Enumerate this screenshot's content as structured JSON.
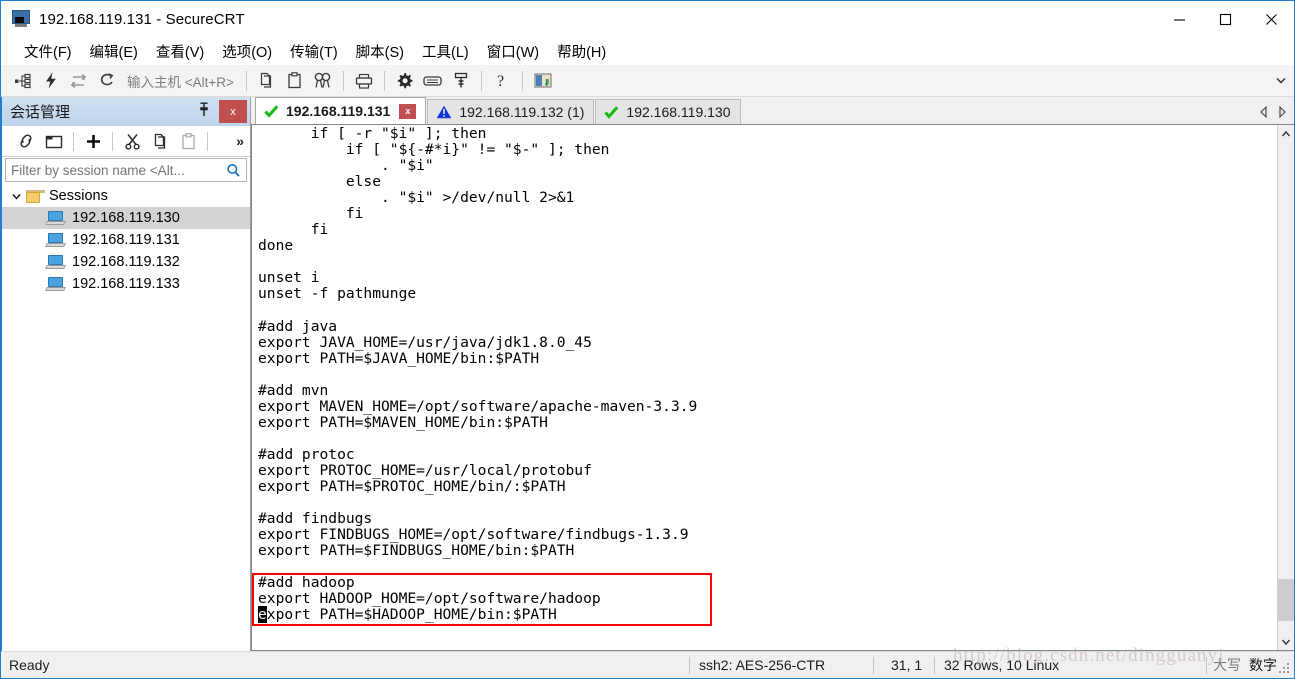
{
  "window": {
    "title": "192.168.119.131 - SecureCRT",
    "icon": "securecrt-icon",
    "minimize": "—",
    "maximize": "□",
    "close": "✕"
  },
  "menubar": {
    "items": [
      {
        "label": "文件(F)",
        "name": "menu-file"
      },
      {
        "label": "编辑(E)",
        "name": "menu-edit"
      },
      {
        "label": "查看(V)",
        "name": "menu-view"
      },
      {
        "label": "选项(O)",
        "name": "menu-options"
      },
      {
        "label": "传输(T)",
        "name": "menu-transfer"
      },
      {
        "label": "脚本(S)",
        "name": "menu-script"
      },
      {
        "label": "工具(L)",
        "name": "menu-tools"
      },
      {
        "label": "窗口(W)",
        "name": "menu-window"
      },
      {
        "label": "帮助(H)",
        "name": "menu-help"
      }
    ]
  },
  "toolbar": {
    "host_placeholder": "输入主机 <Alt+R>",
    "icons": [
      "new-session-icon",
      "quick-connect-icon",
      "reconnect-icon",
      "reconnect-all-icon",
      "copy-icon",
      "paste-icon",
      "find-icon",
      "print-icon",
      "session-options-icon",
      "keymap-editor-icon",
      "filter-icon",
      "help-icon",
      "session-manager-toggle-icon"
    ],
    "dropdown": "chevron-down-icon"
  },
  "session_manager": {
    "title": "会话管理",
    "pin": "pin-icon",
    "close": "x",
    "toolbar_icons": [
      "connect-icon",
      "connect-in-tab-icon",
      "new-session-icon",
      "cut-icon",
      "copy-icon",
      "paste-icon"
    ],
    "overflow": "»",
    "filter_placeholder": "Filter by session name <Alt...",
    "filter_value": "",
    "search_icon": "search-icon",
    "tree": {
      "root": {
        "label": "Sessions",
        "expanded": true,
        "arrow": "chevron-down-icon",
        "icon": "folder-icon"
      },
      "children": [
        {
          "label": "192.168.119.130",
          "icon": "monitor-icon",
          "selected": true
        },
        {
          "label": "192.168.119.131",
          "icon": "monitor-icon",
          "selected": false
        },
        {
          "label": "192.168.119.132",
          "icon": "monitor-icon",
          "selected": false
        },
        {
          "label": "192.168.119.133",
          "icon": "monitor-icon",
          "selected": false
        }
      ]
    }
  },
  "tabs": {
    "items": [
      {
        "label": "192.168.119.131",
        "status": "connected",
        "active": true,
        "closable": true,
        "close_label": "x"
      },
      {
        "label": "192.168.119.132 (1)",
        "status": "warning",
        "active": false,
        "closable": false
      },
      {
        "label": "192.168.119.130",
        "status": "connected",
        "active": false,
        "closable": false
      }
    ],
    "nav_prev": "chevron-left-icon",
    "nav_next": "chevron-right-icon"
  },
  "terminal": {
    "lines": [
      "      if [ -r \"$i\" ]; then",
      "          if [ \"${-#*i}\" != \"$-\" ]; then",
      "              . \"$i\"",
      "          else",
      "              . \"$i\" >/dev/null 2>&1",
      "          fi",
      "      fi",
      "done",
      "",
      "unset i",
      "unset -f pathmunge",
      "",
      "#add java",
      "export JAVA_HOME=/usr/java/jdk1.8.0_45",
      "export PATH=$JAVA_HOME/bin:$PATH",
      "",
      "#add mvn",
      "export MAVEN_HOME=/opt/software/apache-maven-3.3.9",
      "export PATH=$MAVEN_HOME/bin:$PATH",
      "",
      "#add protoc",
      "export PROTOC_HOME=/usr/local/protobuf",
      "export PATH=$PROTOC_HOME/bin/:$PATH",
      "",
      "#add findbugs",
      "export FINDBUGS_HOME=/opt/software/findbugs-1.3.9",
      "export PATH=$FINDBUGS_HOME/bin:$PATH",
      "",
      "#add hadoop",
      "export HADOOP_HOME=/opt/software/hadoop"
    ],
    "last_line": {
      "cursor_char": "e",
      "rest": "xport PATH=$HADOOP_HOME/bin:$PATH"
    },
    "highlight": {
      "color": "#ff0000",
      "label": "hadoop-env-highlight"
    },
    "scroll": {
      "up_arrow": "chevron-up-icon",
      "down_arrow": "chevron-down-icon"
    }
  },
  "statusbar": {
    "ready": "Ready",
    "protocol": "ssh2: AES-256-CTR",
    "position": "31, 1",
    "dimensions": "32 Rows, 10 Linux",
    "caps": "大写",
    "num": "数字"
  },
  "watermark": "http://blog.csdn.net/dingguanyi"
}
